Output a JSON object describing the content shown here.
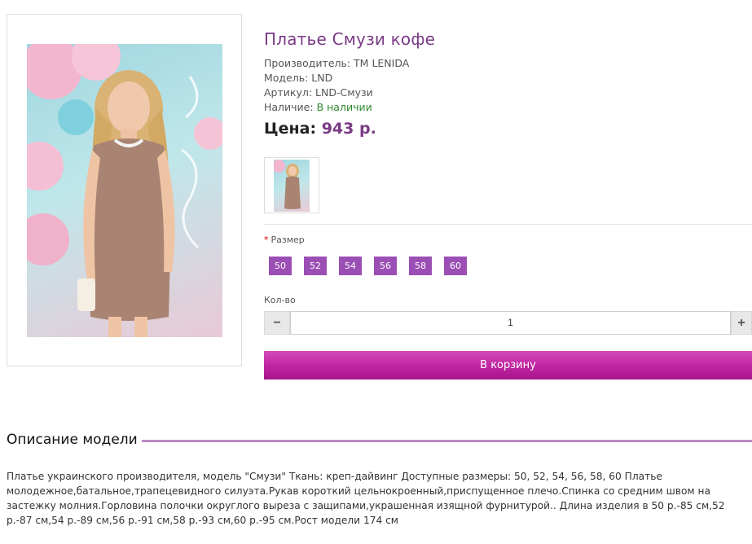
{
  "product": {
    "title": "Платье Смузи кофе",
    "manufacturer": "Производитель: ТМ LENIDA",
    "model": "Модель: LND",
    "sku": "Артикул: LND-Смузи",
    "availability_label": "Наличие:",
    "availability_value": "В наличии",
    "price_label": "Цена:",
    "price_value": "943 р."
  },
  "options": {
    "size_label": "Размер",
    "required_mark": "*",
    "sizes": [
      "50",
      "52",
      "54",
      "56",
      "58",
      "60"
    ]
  },
  "quantity": {
    "label": "Кол-во",
    "minus": "−",
    "value": "1",
    "plus": "+"
  },
  "cart_button": "В корзину",
  "description": {
    "heading": "Описание модели",
    "text": "Платье украинского производителя, модель \"Смузи\" Ткань: креп-дайвинг Доступные размеры: 50, 52, 54, 56, 58, 60 Платье молодежное,батальное,трапецевидного силуэта.Рукав короткий цельнокроенный,приспущенное плечо.Спинка со средним швом на застежку молния.Горловина полочки округлого выреза с защипами,украшенная изящной фурнитурой.. Длина изделия в 50 р.-85 см,52 р.-87 см,54 р.-89 см,56 р.-91 см,58 р.-93 см,60 р.-95 см.Рост модели 174 см"
  },
  "colors": {
    "accent": "#7a3a85",
    "size_button": "#9b4fb5",
    "cart_button": "#c22aa4",
    "in_stock": "#2d8a2d"
  }
}
